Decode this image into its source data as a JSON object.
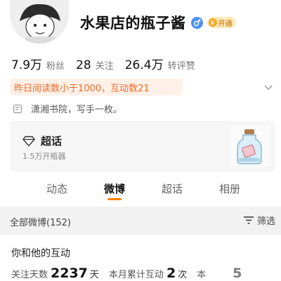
{
  "profile": {
    "nickname": "水果店的瓶子酱",
    "vip_label": "开通",
    "stats": [
      {
        "value": "7.9万",
        "label": "粉丝"
      },
      {
        "value": "28",
        "label": "关注"
      },
      {
        "value": "26.4万",
        "label": "转评赞"
      }
    ],
    "notice": "昨日阅读数小于1000，互动数21",
    "bio": "潇湘书院，写手一枚。"
  },
  "supertopic": {
    "title": "超话",
    "subtitle": "1.5万开瓶器"
  },
  "tabs": [
    {
      "label": "动态",
      "active": false
    },
    {
      "label": "微博",
      "active": true
    },
    {
      "label": "超话",
      "active": false
    },
    {
      "label": "相册",
      "active": false
    }
  ],
  "feed": {
    "all_label": "全部微博(152)",
    "filter_label": "筛选"
  },
  "interaction": {
    "title": "你和他的互动",
    "items": [
      {
        "label": "关注天数",
        "value": "2237",
        "unit": "天"
      },
      {
        "label": "本月累计互动",
        "value": "2",
        "unit": "次"
      },
      {
        "label": "本",
        "value": "5",
        "unit": ""
      }
    ]
  },
  "colors": {
    "accent": "#ff8200",
    "notice_text": "#f26a2a",
    "notice_bg": "#fff1e8",
    "gender": "#4a8ff5"
  },
  "icons": {
    "gender": "male-icon",
    "vip": "vip-crown-icon",
    "expand": "chevron-down-icon",
    "bio": "info-doc-icon",
    "supertopic": "diamond-icon",
    "filter": "filter-icon"
  }
}
